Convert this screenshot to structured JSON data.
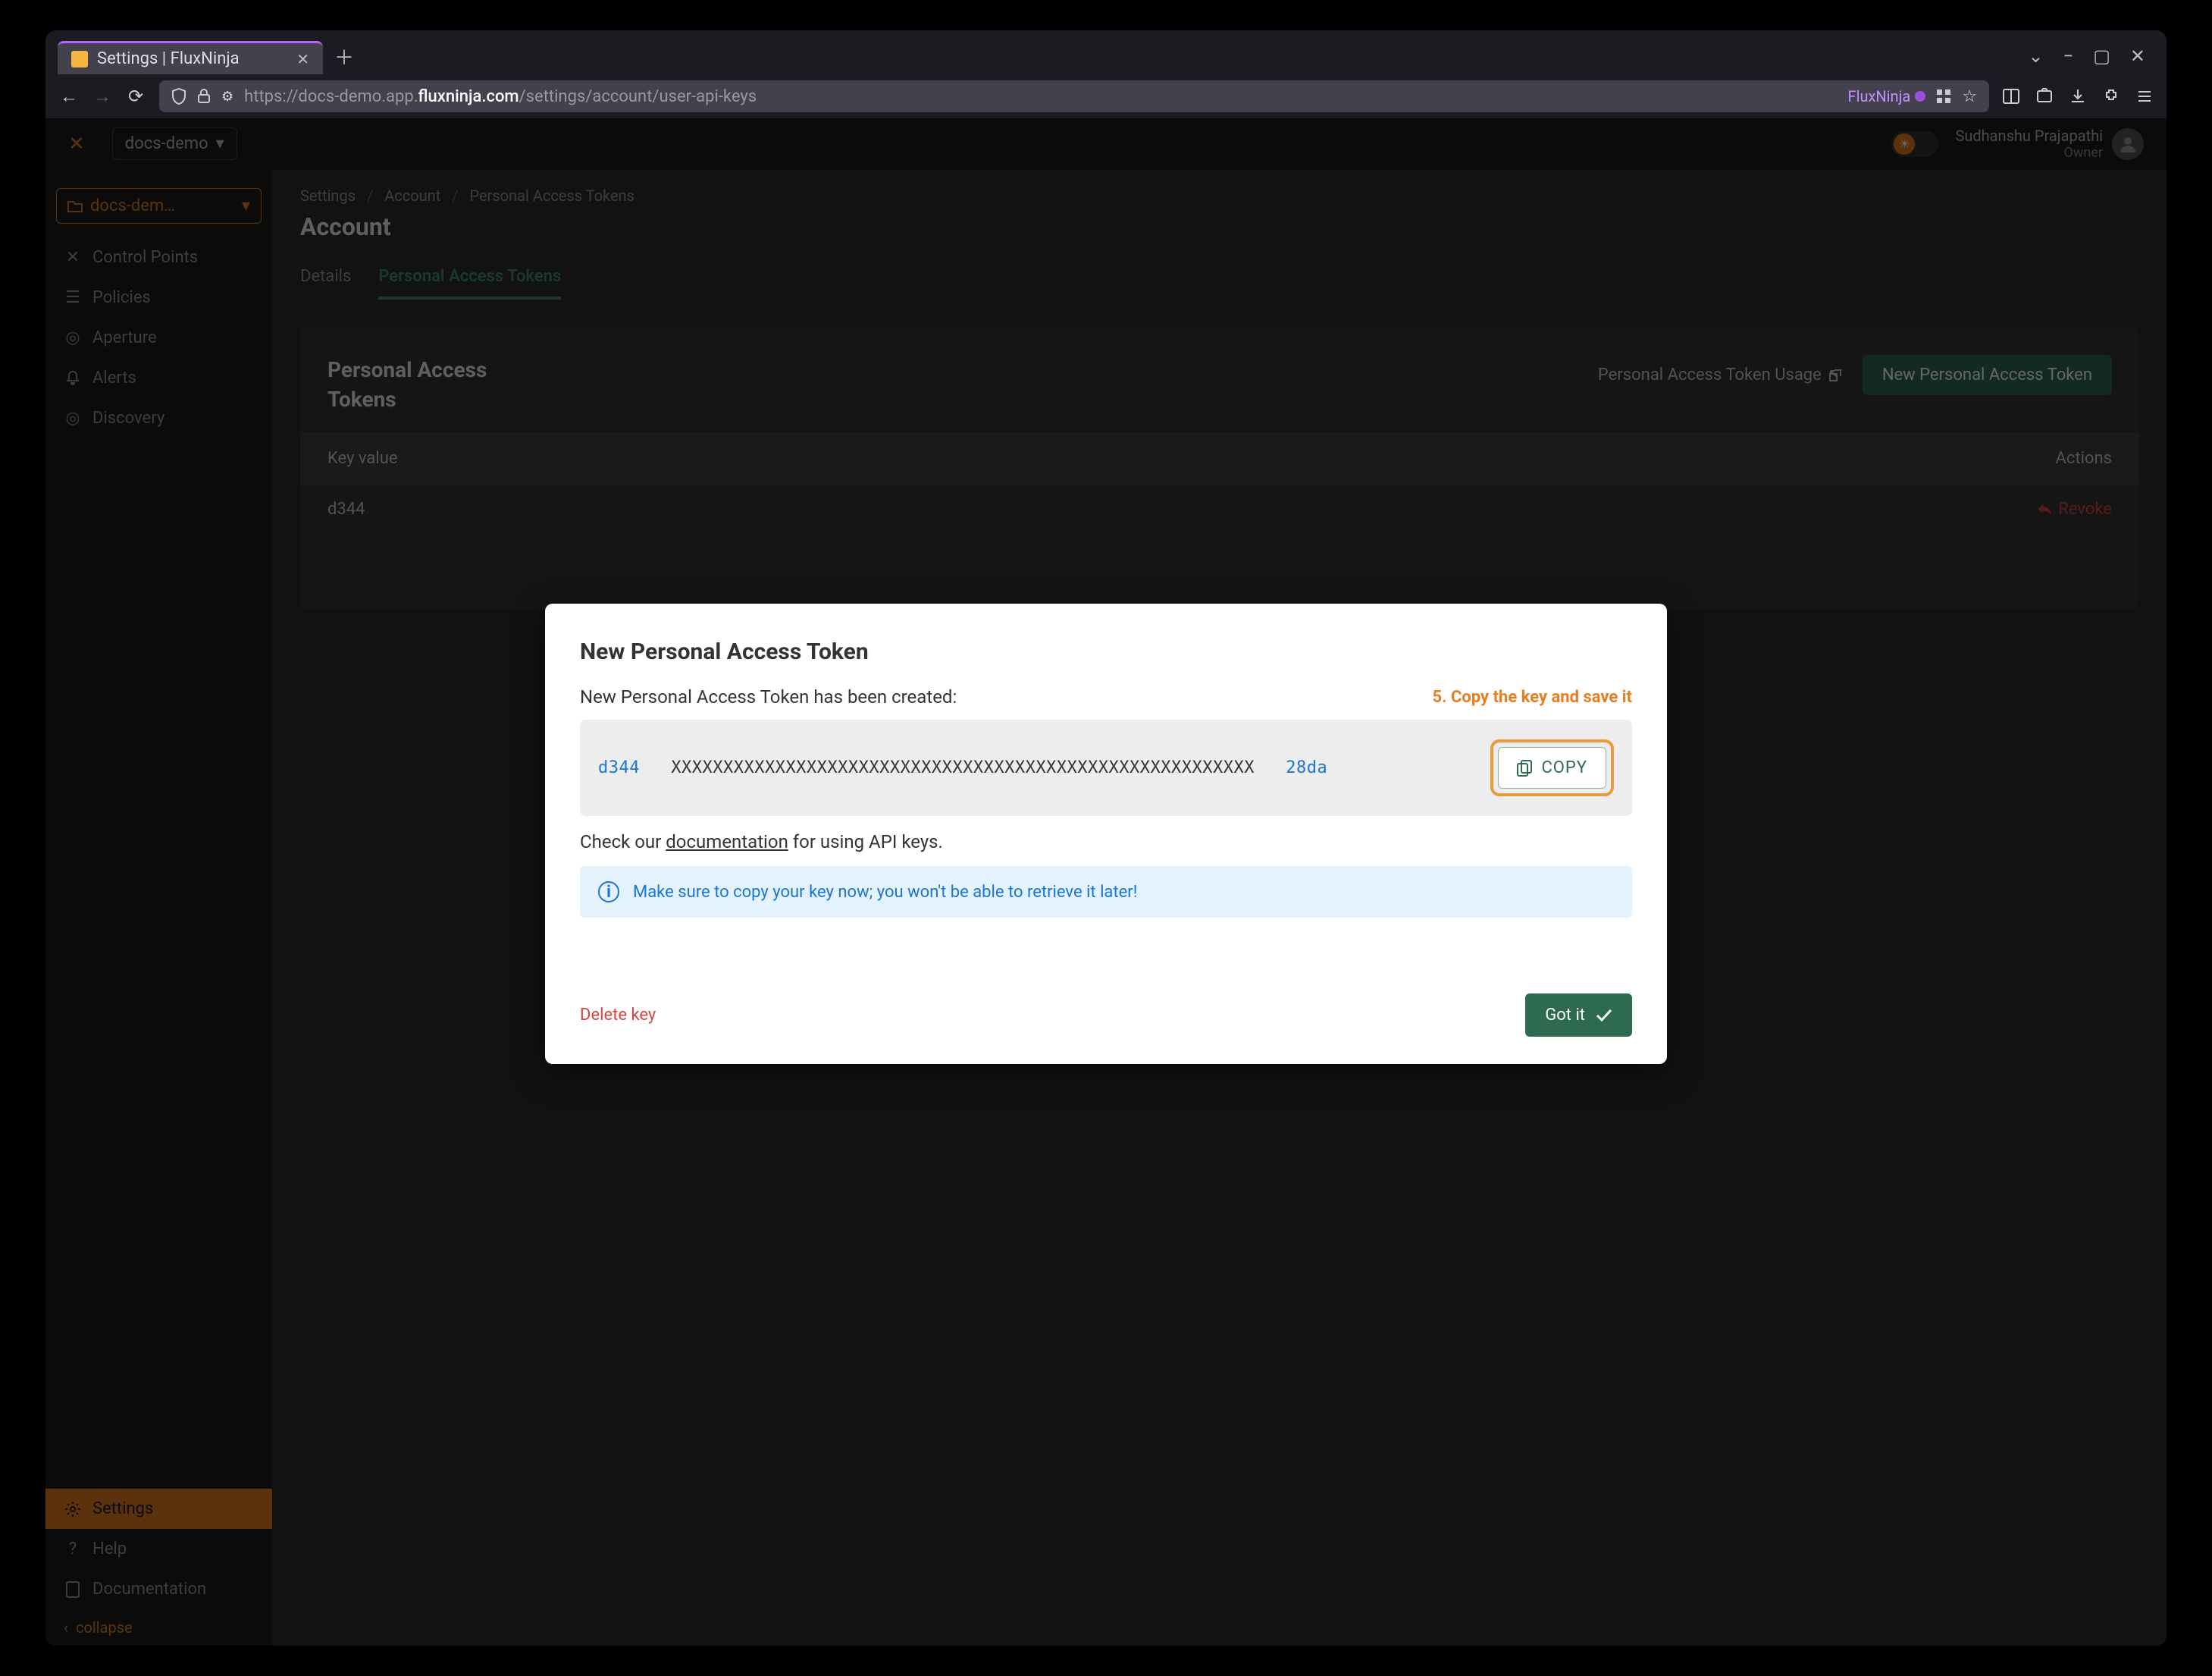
{
  "browser": {
    "tab_title": "Settings | FluxNinja",
    "url_prefix": "https://docs-demo.app.",
    "url_domain": "fluxninja.com",
    "url_path": "/settings/account/user-api-keys",
    "extension_label": "FluxNinja"
  },
  "topbar": {
    "project": "docs-demo",
    "user_name": "Sudhanshu Prajapathi",
    "user_role": "Owner"
  },
  "sidebar": {
    "project_select": "docs-dem…",
    "items": [
      {
        "label": "Control Points"
      },
      {
        "label": "Policies"
      },
      {
        "label": "Aperture"
      },
      {
        "label": "Alerts"
      },
      {
        "label": "Discovery"
      }
    ],
    "bottom": [
      {
        "label": "Settings"
      },
      {
        "label": "Help"
      },
      {
        "label": "Documentation"
      }
    ],
    "collapse_label": "collapse"
  },
  "breadcrumbs": [
    "Settings",
    "Account",
    "Personal Access Tokens"
  ],
  "page_title": "Account",
  "tabs": [
    {
      "label": "Details"
    },
    {
      "label": "Personal Access Tokens"
    }
  ],
  "card": {
    "title": "Personal Access Tokens",
    "usage_link": "Personal Access Token Usage",
    "new_token_btn": "New Personal Access Token",
    "columns": {
      "key": "Key value",
      "actions": "Actions"
    },
    "row_key": "d344",
    "revoke_label": "Revoke"
  },
  "modal": {
    "title": "New Personal Access Token",
    "created_text": "New Personal Access Token has been created:",
    "step_label": "5. Copy the key and save it",
    "token_prefix": "d344",
    "token_mask": "XXXXXXXXXXXXXXXXXXXXXXXXXXXXXXXXXXXXXXXXXXXXXXXXXXXXXXXX",
    "token_suffix": "28da",
    "copy_label": "COPY",
    "doc_pre": "Check our ",
    "doc_link": "documentation",
    "doc_post": " for using API keys.",
    "info_text": "Make sure to copy your key now; you won't be able to retrieve it later!",
    "delete_label": "Delete key",
    "gotit_label": "Got it"
  }
}
